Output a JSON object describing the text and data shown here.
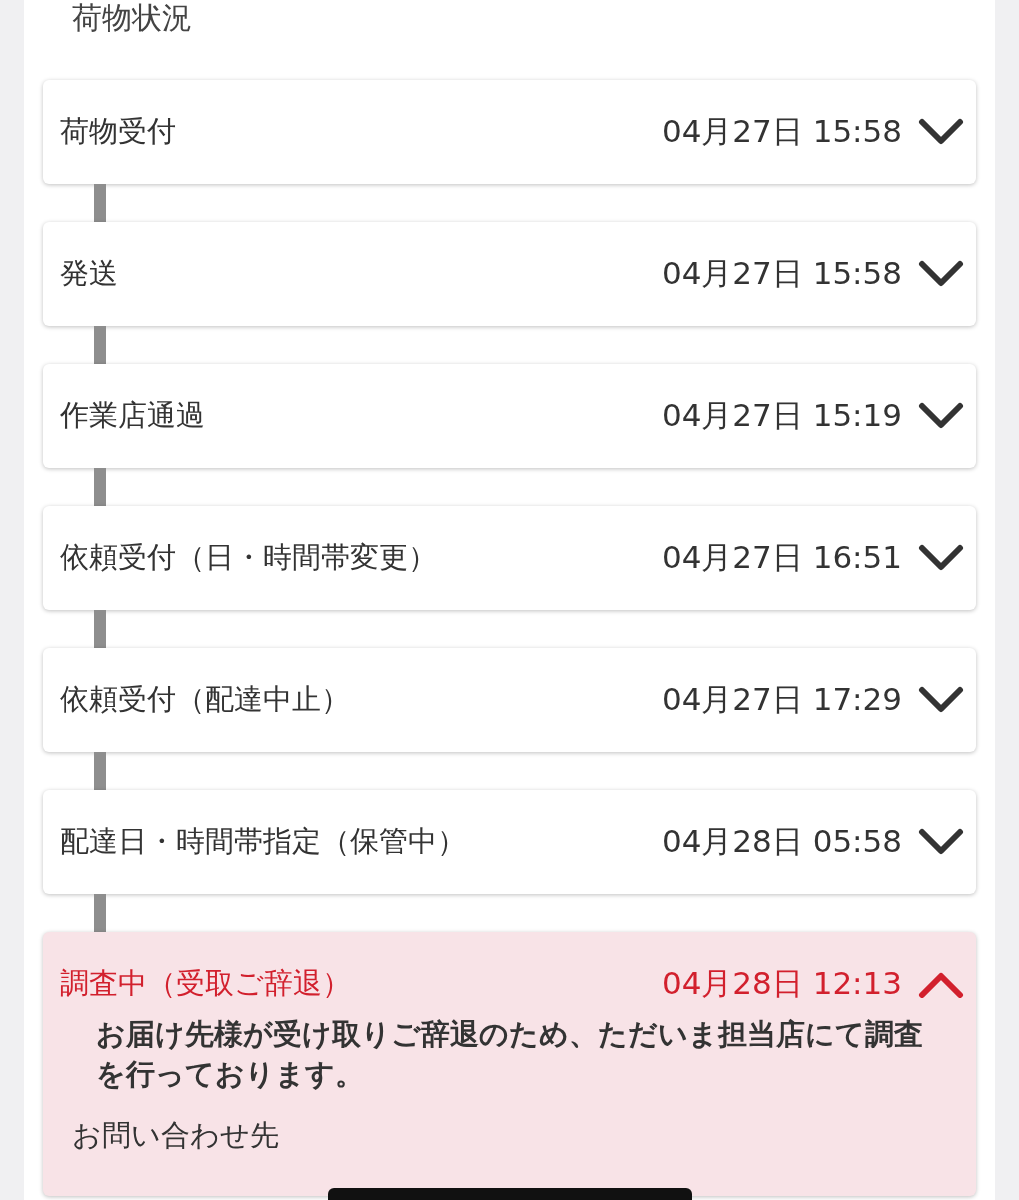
{
  "section_title": "荷物状況",
  "events": [
    {
      "name": "荷物受付",
      "datetime": "04月27日 15:58",
      "kind": "normal",
      "expanded": false
    },
    {
      "name": "発送",
      "datetime": "04月27日 15:58",
      "kind": "normal",
      "expanded": false
    },
    {
      "name": "作業店通過",
      "datetime": "04月27日 15:19",
      "kind": "normal",
      "expanded": false
    },
    {
      "name": "依頼受付（日・時間帯変更）",
      "datetime": "04月27日 16:51",
      "kind": "normal",
      "expanded": false
    },
    {
      "name": "依頼受付（配達中止）",
      "datetime": "04月27日 17:29",
      "kind": "normal",
      "expanded": false
    },
    {
      "name": "配達日・時間帯指定（保管中）",
      "datetime": "04月28日 05:58",
      "kind": "normal",
      "expanded": false
    },
    {
      "name": "調査中（受取ご辞退）",
      "datetime": "04月28日 12:13",
      "kind": "alert",
      "expanded": true,
      "message": "お届け先様が受け取りご辞退のため、ただいま担当店にて調査を行っております。",
      "contact_label": "お問い合わせ先"
    }
  ]
}
